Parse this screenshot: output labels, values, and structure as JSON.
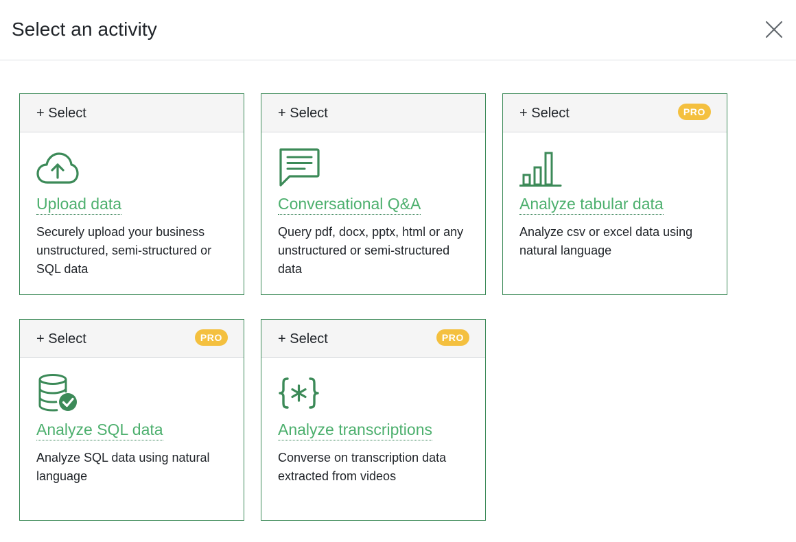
{
  "dialog": {
    "title": "Select an activity",
    "close_icon": "close-icon"
  },
  "colors": {
    "accent_green": "#3c8a58",
    "link_green": "#4caf6d",
    "pro_badge": "#f4c03f",
    "card_header_bg": "#f5f5f5"
  },
  "cards": [
    {
      "select_label": "+ Select",
      "pro": "",
      "icon": "cloud-upload-icon",
      "title": "Upload data",
      "description": "Securely upload your business unstructured, semi-structured or SQL data"
    },
    {
      "select_label": "+ Select",
      "pro": "",
      "icon": "chat-message-icon",
      "title": "Conversational Q&A",
      "description": "Query pdf, docx, pptx, html or any unstructured or semi-structured data"
    },
    {
      "select_label": "+ Select",
      "pro": "PRO",
      "icon": "bar-chart-icon",
      "title": "Analyze tabular data",
      "description": "Analyze csv or excel data using natural language"
    },
    {
      "select_label": "+ Select",
      "pro": "PRO",
      "icon": "database-check-icon",
      "title": "Analyze SQL data",
      "description": "Analyze SQL data using natural language"
    },
    {
      "select_label": "+ Select",
      "pro": "PRO",
      "icon": "curly-braces-asterisk-icon",
      "title": "Analyze transcriptions",
      "description": "Converse on transcription data extracted from videos"
    }
  ]
}
